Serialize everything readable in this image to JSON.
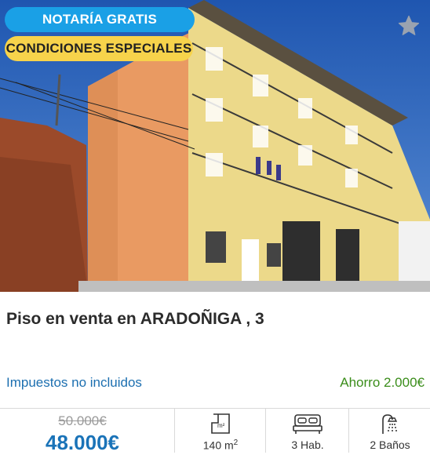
{
  "badges": {
    "notary": "NOTARÍA GRATIS",
    "special": "CONDICIONES ESPECIALES"
  },
  "listing": {
    "title": "Piso en venta en ARADOÑIGA , 3",
    "taxes_note": "Impuestos no incluidos",
    "savings": "Ahorro 2.000€",
    "old_price": "50.000€",
    "new_price": "48.000€"
  },
  "features": {
    "area_value": "140 m",
    "area_unit_sup": "2",
    "rooms": "3 Hab.",
    "baths": "2 Baños"
  },
  "icons": {
    "favorite": "star-icon",
    "area": "floor-plan-icon",
    "rooms": "bed-icon",
    "baths": "shower-icon"
  },
  "colors": {
    "notary_badge": "#1aa0e6",
    "special_badge": "#f7d34b",
    "price": "#1a73b8",
    "savings": "#3a8d1a",
    "taxes": "#1c6fb0"
  }
}
